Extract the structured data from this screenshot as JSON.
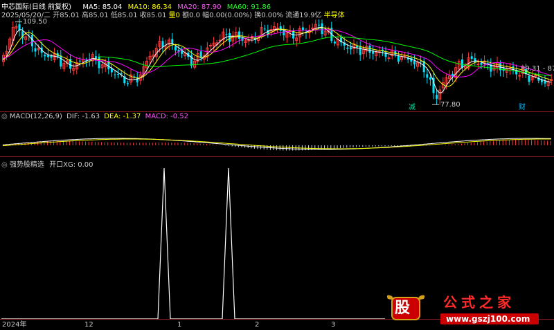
{
  "header": {
    "stock_name": "中芯国际(日线 前复权)",
    "ma5_label": "MA5: 85.04",
    "ma10_label": "MA10: 86.34",
    "ma20_label": "MA20: 87.90",
    "ma60_label": "MA60: 91.86",
    "date": "2025/05/20/二",
    "open": "开85.01",
    "high": "高85.01",
    "low": "低85.01",
    "close": "收85.01",
    "volume": "量0",
    "amount": "额0.0",
    "change": "幅0.00(0.00%)",
    "turnover": "换0.00%",
    "float": "流通19.9亿",
    "industry": "半导体"
  },
  "annotations": {
    "high_price": "109.50",
    "low_price": "77.80",
    "right_price": "89.31 - 87",
    "marker_reduce": "减",
    "marker_finance": "财"
  },
  "macd_panel": {
    "title": "MACD(12,26,9)",
    "dif": "DIF: -1.63",
    "dea": "DEA: -1.37",
    "macd": "MACD: -0.52"
  },
  "indicator_panel": {
    "title": "强势股精选",
    "signal": "开口XG: 0.00"
  },
  "x_axis": {
    "labels": [
      "2024年",
      "12",
      "1",
      "2",
      "3"
    ]
  },
  "watermark": {
    "logo_char": "股",
    "site_name": "公式之家",
    "url": "www.gszj100.com"
  },
  "colors": {
    "background": "#000000",
    "up": "#ff3b3b",
    "down": "#00e5ff",
    "ma5": "#ffffff",
    "ma10": "#ffff00",
    "ma20": "#ff00ff",
    "ma60": "#00ff00",
    "panel_divider": "#8b1a1a",
    "signal_line": "#ffffff"
  },
  "chart_data": [
    {
      "type": "candlestick",
      "series": [
        {
          "name": "MA5",
          "value": 85.04
        },
        {
          "name": "MA10",
          "value": 86.34
        },
        {
          "name": "MA20",
          "value": 87.9
        },
        {
          "name": "MA60",
          "value": 91.86
        }
      ],
      "annotations": [
        {
          "label": "109.50",
          "value": 109.5
        },
        {
          "label": "77.80",
          "value": 77.8
        }
      ],
      "ylim": [
        76,
        111
      ]
    },
    {
      "type": "line",
      "series": [
        {
          "name": "DIF",
          "value": -1.63
        },
        {
          "name": "DEA",
          "value": -1.37
        },
        {
          "name": "MACD",
          "value": -0.52
        }
      ]
    },
    {
      "type": "line",
      "series": [
        {
          "name": "开口XG",
          "value": 0.0
        }
      ],
      "spikes": 2
    }
  ]
}
